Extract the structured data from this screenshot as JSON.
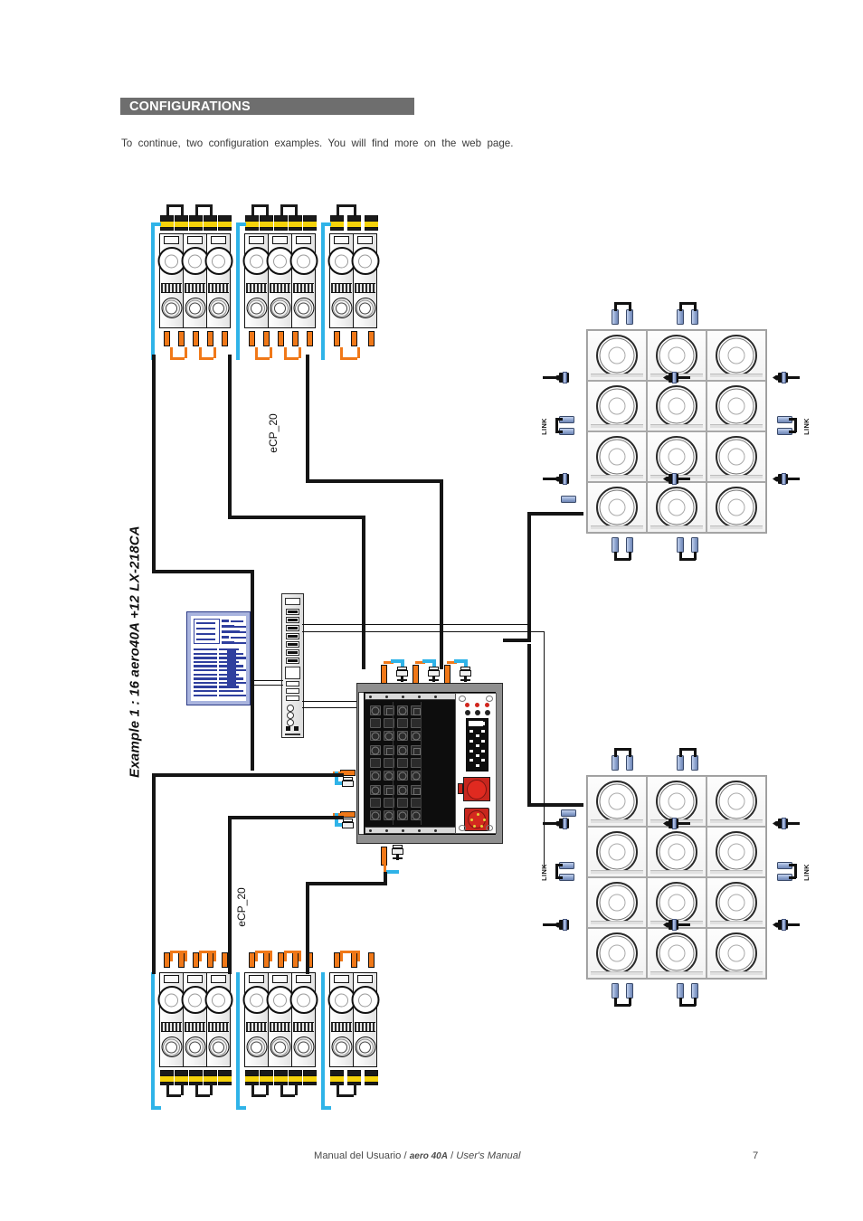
{
  "document": {
    "section_heading": "CONFIGURATIONS",
    "intro_text": "To continue, two configuration examples. You will find more on the web page.",
    "example_title": "Example 1 : 16 aero40A +12 LX-218CA",
    "footer_prefix": "Manual del Usuario",
    "footer_sep1": " / ",
    "footer_product": "aero 40A",
    "footer_sep2": " / ",
    "footer_suffix": "User's Manual",
    "page_number": "7"
  },
  "diagram": {
    "labels": {
      "ecp_top": "eCP_20",
      "ecp_bottom": "eCP_20",
      "link_tl": "LINK",
      "link_tr": "LINK",
      "link_bl": "LINK",
      "link_br": "LINK"
    },
    "colors": {
      "header_bar": "#6e6e6e",
      "power_cable": "#F07818",
      "data_cable": "#2FB3E8",
      "signal_cable": "#151515",
      "speakon_yellow": "#F5D20A",
      "xlr_blue": "#8fa5cf",
      "emergency_red": "#D0241C",
      "laptop_blue": "#2F3F9E"
    },
    "top_array": {
      "groups": [
        {
          "cabinets": 3,
          "speakon_plugs": 5,
          "power_plugs": 5
        },
        {
          "cabinets": 3,
          "speakon_plugs": 5,
          "power_plugs": 5
        },
        {
          "cabinets": 2,
          "speakon_plugs": 3,
          "power_plugs": 3
        }
      ]
    },
    "bottom_array": {
      "groups": [
        {
          "cabinets": 3,
          "speakon_plugs": 5,
          "power_plugs": 5
        },
        {
          "cabinets": 3,
          "speakon_plugs": 5,
          "power_plugs": 5
        },
        {
          "cabinets": 2,
          "speakon_plugs": 3,
          "power_plugs": 3
        }
      ]
    },
    "sub_array_top": {
      "columns": 3,
      "rows": 4,
      "total": 12
    },
    "sub_array_bottom": {
      "columns": 3,
      "rows": 4,
      "total": 12
    },
    "rack": {
      "outlet_columns": 2,
      "outlet_rows": 9,
      "led_count": 3,
      "top_connectors": 3
    }
  }
}
